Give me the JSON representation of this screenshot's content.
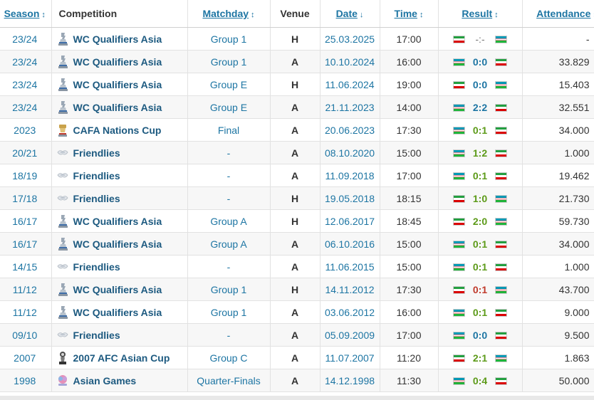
{
  "headers": {
    "season": "Season",
    "competition": "Competition",
    "matchday": "Matchday",
    "venue": "Venue",
    "date": "Date",
    "time": "Time",
    "result": "Result",
    "attendance": "Attendance"
  },
  "sort_icons": {
    "updown": "↕",
    "down": "↓"
  },
  "colors": {
    "link": "#1d75a3",
    "win": "#5c9a18",
    "loss": "#c0392b",
    "draw": "#1d75a3"
  },
  "rows": [
    {
      "season": "23/24",
      "icon": "wc-qualifiers-icon",
      "competition": "WC Qualifiers Asia",
      "matchday": "Group 1",
      "venue": "H",
      "date": "25.03.2025",
      "time": "17:00",
      "home_flag": "iran-flag",
      "score": "-:-",
      "outcome": "none",
      "away_flag": "uzbekistan-flag",
      "attendance": "-"
    },
    {
      "season": "23/24",
      "icon": "wc-qualifiers-icon",
      "competition": "WC Qualifiers Asia",
      "matchday": "Group 1",
      "venue": "A",
      "date": "10.10.2024",
      "time": "16:00",
      "home_flag": "uzbekistan-flag",
      "score": "0:0",
      "outcome": "draw",
      "away_flag": "iran-flag",
      "attendance": "33.829"
    },
    {
      "season": "23/24",
      "icon": "wc-qualifiers-icon",
      "competition": "WC Qualifiers Asia",
      "matchday": "Group E",
      "venue": "H",
      "date": "11.06.2024",
      "time": "19:00",
      "home_flag": "iran-flag",
      "score": "0:0",
      "outcome": "draw",
      "away_flag": "uzbekistan-flag",
      "attendance": "15.403"
    },
    {
      "season": "23/24",
      "icon": "wc-qualifiers-icon",
      "competition": "WC Qualifiers Asia",
      "matchday": "Group E",
      "venue": "A",
      "date": "21.11.2023",
      "time": "14:00",
      "home_flag": "uzbekistan-flag",
      "score": "2:2",
      "outcome": "draw",
      "away_flag": "iran-flag",
      "attendance": "32.551"
    },
    {
      "season": "2023",
      "icon": "cafa-cup-icon",
      "competition": "CAFA Nations Cup",
      "matchday": "Final",
      "venue": "A",
      "date": "20.06.2023",
      "time": "17:30",
      "home_flag": "uzbekistan-flag",
      "score": "0:1",
      "outcome": "win",
      "away_flag": "iran-flag",
      "attendance": "34.000"
    },
    {
      "season": "20/21",
      "icon": "friendlies-icon",
      "competition": "Friendlies",
      "matchday": "-",
      "venue": "A",
      "date": "08.10.2020",
      "time": "15:00",
      "home_flag": "uzbekistan-flag",
      "score": "1:2",
      "outcome": "win",
      "away_flag": "iran-flag",
      "attendance": "1.000"
    },
    {
      "season": "18/19",
      "icon": "friendlies-icon",
      "competition": "Friendlies",
      "matchday": "-",
      "venue": "A",
      "date": "11.09.2018",
      "time": "17:00",
      "home_flag": "uzbekistan-flag",
      "score": "0:1",
      "outcome": "win",
      "away_flag": "iran-flag",
      "attendance": "19.462"
    },
    {
      "season": "17/18",
      "icon": "friendlies-icon",
      "competition": "Friendlies",
      "matchday": "-",
      "venue": "H",
      "date": "19.05.2018",
      "time": "18:15",
      "home_flag": "iran-flag",
      "score": "1:0",
      "outcome": "win",
      "away_flag": "uzbekistan-flag",
      "attendance": "21.730"
    },
    {
      "season": "16/17",
      "icon": "wc-qualifiers-icon",
      "competition": "WC Qualifiers Asia",
      "matchday": "Group A",
      "venue": "H",
      "date": "12.06.2017",
      "time": "18:45",
      "home_flag": "iran-flag",
      "score": "2:0",
      "outcome": "win",
      "away_flag": "uzbekistan-flag",
      "attendance": "59.730"
    },
    {
      "season": "16/17",
      "icon": "wc-qualifiers-icon",
      "competition": "WC Qualifiers Asia",
      "matchday": "Group A",
      "venue": "A",
      "date": "06.10.2016",
      "time": "15:00",
      "home_flag": "uzbekistan-flag",
      "score": "0:1",
      "outcome": "win",
      "away_flag": "iran-flag",
      "attendance": "34.000"
    },
    {
      "season": "14/15",
      "icon": "friendlies-icon",
      "competition": "Friendlies",
      "matchday": "-",
      "venue": "A",
      "date": "11.06.2015",
      "time": "15:00",
      "home_flag": "uzbekistan-flag",
      "score": "0:1",
      "outcome": "win",
      "away_flag": "iran-flag",
      "attendance": "1.000"
    },
    {
      "season": "11/12",
      "icon": "wc-qualifiers-icon",
      "competition": "WC Qualifiers Asia",
      "matchday": "Group 1",
      "venue": "H",
      "date": "14.11.2012",
      "time": "17:30",
      "home_flag": "iran-flag",
      "score": "0:1",
      "outcome": "loss",
      "away_flag": "uzbekistan-flag",
      "attendance": "43.700"
    },
    {
      "season": "11/12",
      "icon": "wc-qualifiers-icon",
      "competition": "WC Qualifiers Asia",
      "matchday": "Group 1",
      "venue": "A",
      "date": "03.06.2012",
      "time": "16:00",
      "home_flag": "uzbekistan-flag",
      "score": "0:1",
      "outcome": "win",
      "away_flag": "iran-flag",
      "attendance": "9.000"
    },
    {
      "season": "09/10",
      "icon": "friendlies-icon",
      "competition": "Friendlies",
      "matchday": "-",
      "venue": "A",
      "date": "05.09.2009",
      "time": "17:00",
      "home_flag": "uzbekistan-flag",
      "score": "0:0",
      "outcome": "draw",
      "away_flag": "iran-flag",
      "attendance": "9.500"
    },
    {
      "season": "2007",
      "icon": "afc-asian-cup-icon",
      "competition": "2007 AFC Asian Cup",
      "matchday": "Group C",
      "venue": "A",
      "date": "11.07.2007",
      "time": "11:20",
      "home_flag": "iran-flag",
      "score": "2:1",
      "outcome": "win",
      "away_flag": "uzbekistan-flag",
      "attendance": "1.863"
    },
    {
      "season": "1998",
      "icon": "asian-games-icon",
      "competition": "Asian Games",
      "matchday": "Quarter-Finals",
      "venue": "A",
      "date": "14.12.1998",
      "time": "11:30",
      "home_flag": "uzbekistan-flag",
      "score": "0:4",
      "outcome": "win",
      "away_flag": "iran-flag",
      "attendance": "50.000"
    }
  ]
}
